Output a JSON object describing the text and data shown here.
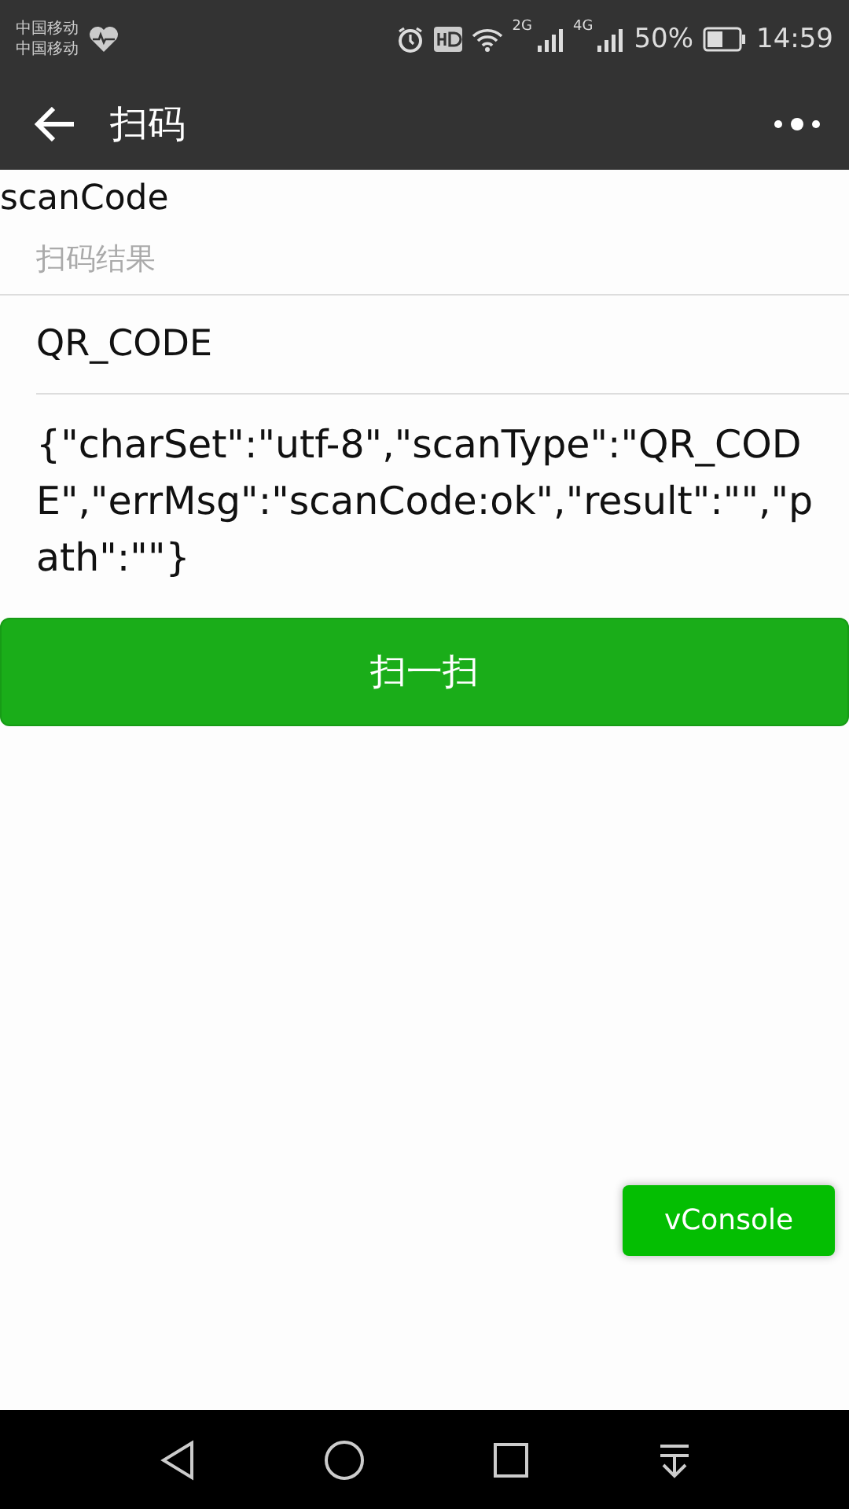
{
  "status_bar": {
    "carriers": [
      "中国移动",
      "中国移动"
    ],
    "network_labels": [
      "2G",
      "4G"
    ],
    "battery_percent": "50%",
    "time": "14:59"
  },
  "nav_bar": {
    "title": "扫码"
  },
  "page_title": "scanCode",
  "result_field": {
    "placeholder": "扫码结果"
  },
  "scan_type": "QR_CODE",
  "raw_result": "{\"charSet\":\"utf-8\",\"scanType\":\"QR_CODE\",\"errMsg\":\"scanCode:ok\",\"result\":\"\",\"path\":\"\"}",
  "scan_button": "扫一扫",
  "vconsole_button": "vConsole"
}
